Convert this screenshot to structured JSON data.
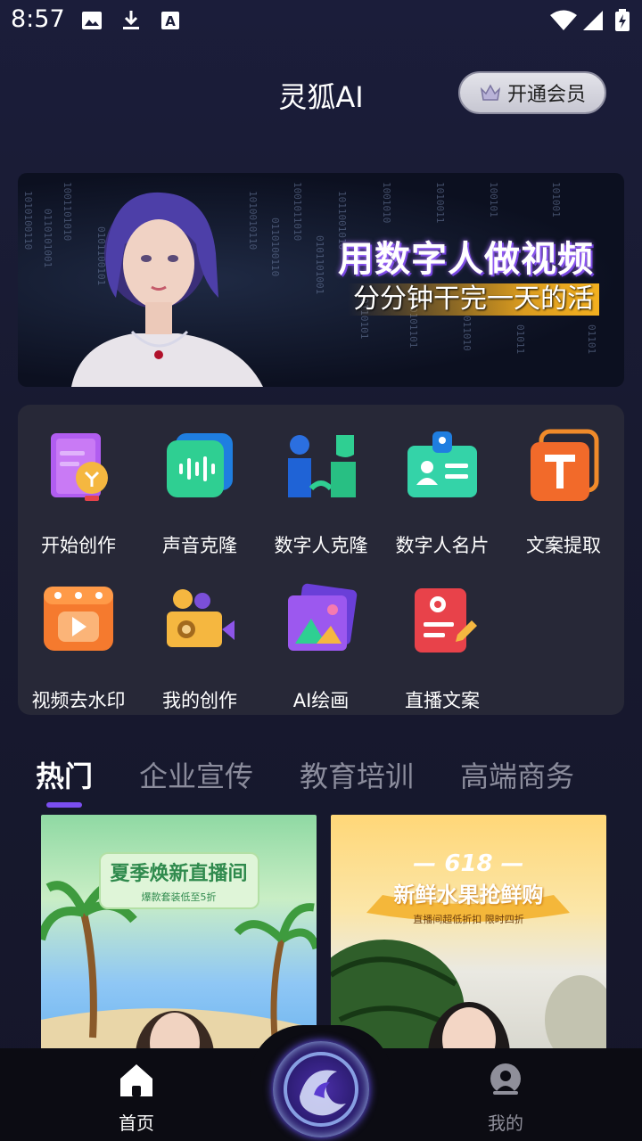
{
  "status_bar": {
    "time": "8:57"
  },
  "header": {
    "title": "灵狐AI",
    "vip_label": "开通会员"
  },
  "banner": {
    "title": "用数字人做视频",
    "subtitle": "分分钟干完一天的活"
  },
  "tools": [
    {
      "label": "开始创作",
      "icon": "document-create-icon"
    },
    {
      "label": "声音克隆",
      "icon": "voice-wave-icon"
    },
    {
      "label": "数字人克隆",
      "icon": "digital-human-clone-icon"
    },
    {
      "label": "数字人名片",
      "icon": "business-card-icon"
    },
    {
      "label": "文案提取",
      "icon": "text-extract-icon"
    },
    {
      "label": "视频去水印",
      "icon": "video-watermark-icon"
    },
    {
      "label": "我的创作",
      "icon": "my-works-camera-icon"
    },
    {
      "label": "AI绘画",
      "icon": "ai-painting-icon"
    },
    {
      "label": "直播文案",
      "icon": "live-script-icon"
    }
  ],
  "category_tabs": [
    "热门",
    "企业宣传",
    "教育培训",
    "高端商务"
  ],
  "active_tab": "热门",
  "templates": [
    {
      "title": "夏季焕新直播间",
      "subtitle": "爆款套装低至5折"
    },
    {
      "tag": "— 618 —",
      "title": "新鲜水果抢鲜购",
      "subtitle": "直播间超低折扣 限时四折"
    }
  ],
  "bottom_nav": {
    "home_label": "首页",
    "mine_label": "我的"
  },
  "colors": {
    "accent": "#7b4ef0",
    "background": "#1b1d3a",
    "panel": "#272837"
  }
}
